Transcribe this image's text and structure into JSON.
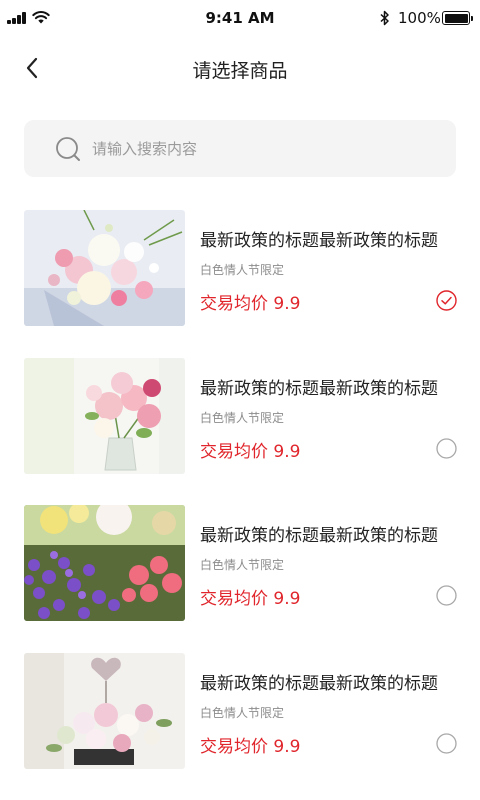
{
  "status_bar": {
    "time": "9:41 AM",
    "battery": "100%"
  },
  "nav": {
    "title": "请选择商品"
  },
  "search": {
    "placeholder": "请输入搜索内容",
    "value": ""
  },
  "colors": {
    "accent": "#e0262c",
    "search_bg": "#f4f4f4",
    "muted_text": "#8c8c8c"
  },
  "products": [
    {
      "title": "最新政策的标题最新政策的标题",
      "tag": "白色情人节限定",
      "price": "交易均价 9.9",
      "selected": true
    },
    {
      "title": "最新政策的标题最新政策的标题",
      "tag": "白色情人节限定",
      "price": "交易均价 9.9",
      "selected": false
    },
    {
      "title": "最新政策的标题最新政策的标题",
      "tag": "白色情人节限定",
      "price": "交易均价 9.9",
      "selected": false
    },
    {
      "title": "最新政策的标题最新政策的标题",
      "tag": "白色情人节限定",
      "price": "交易均价 9.9",
      "selected": false
    }
  ]
}
